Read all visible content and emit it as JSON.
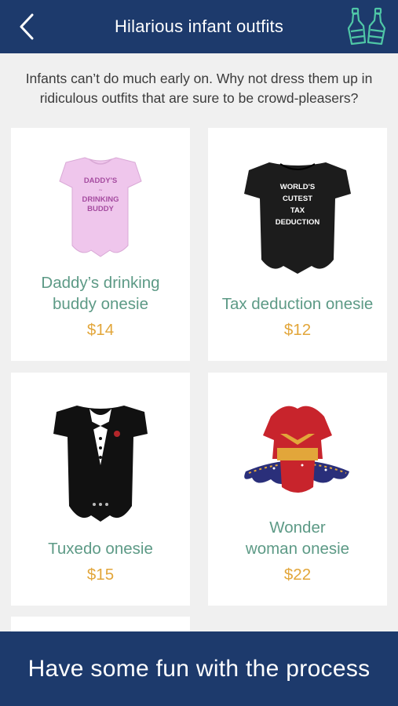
{
  "header": {
    "title": "Hilarious infant outfits",
    "back_icon": "chevron-left-icon",
    "logo_icon": "bottles-icon",
    "accent": "#1d3a6c"
  },
  "intro": "Infants can’t do much early on. Why not dress them up in ridiculous outfits that are sure to be crowd-pleasers?",
  "products": [
    {
      "name_line1": "Daddy’s drinking",
      "name_line2": "buddy onesie",
      "price": "$14",
      "print_lines": [
        "DADDY'S",
        "",
        "DRINKING",
        "BUDDY"
      ]
    },
    {
      "name_line1": "",
      "name_line2": "Tax deduction onesie",
      "price": "$12",
      "print_lines": [
        "WORLD'S",
        "CUTEST",
        "TAX",
        "DEDUCTION"
      ]
    },
    {
      "name_line1": "",
      "name_line2": "Tuxedo onesie",
      "price": "$15"
    },
    {
      "name_line1": "Wonder",
      "name_line2": "woman onesie",
      "price": "$22"
    }
  ],
  "footer": {
    "text": "Have some fun with the process"
  }
}
